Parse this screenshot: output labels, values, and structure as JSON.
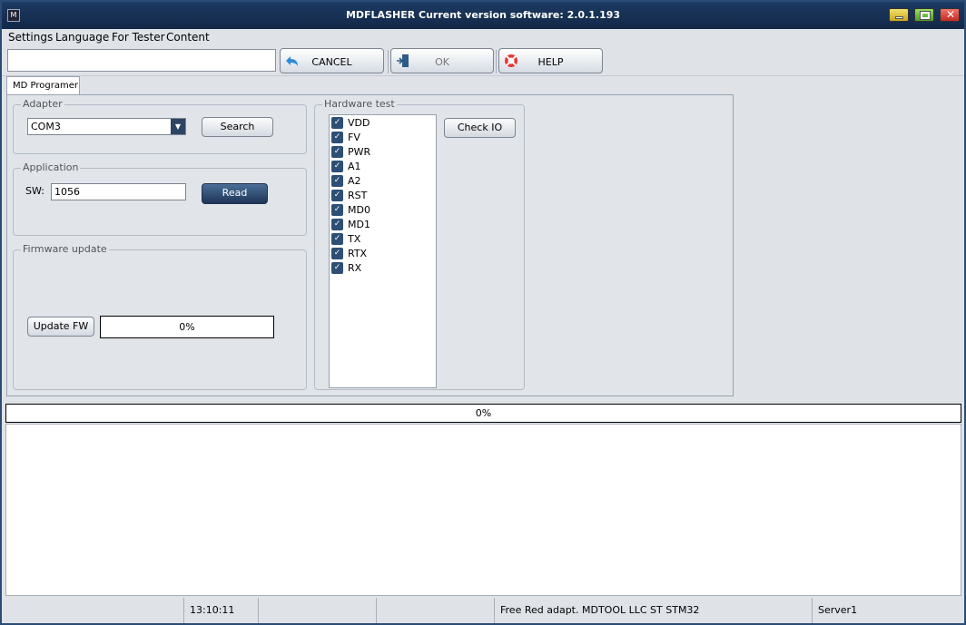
{
  "window": {
    "title": "MDFLASHER  Current version software: 2.0.1.193",
    "app_icon": "mdflasher-logo-icon"
  },
  "menu": [
    "Settings",
    "Language",
    "For Tester",
    "Content"
  ],
  "toolbar": {
    "input_value": "",
    "cancel_label": "CANCEL",
    "ok_label": "OK",
    "help_label": "HELP"
  },
  "tabs": [
    "MD Programer"
  ],
  "adapter": {
    "group_label": "Adapter",
    "selected": "COM3",
    "search_label": "Search"
  },
  "application": {
    "group_label": "Application",
    "sw_label": "SW:",
    "sw_value": "1056",
    "read_label": "Read"
  },
  "firmware": {
    "group_label": "Firmware update",
    "update_label": "Update FW",
    "progress_text": "0%"
  },
  "hardware": {
    "group_label": "Hardware test",
    "check_label": "Check IO",
    "items": [
      {
        "label": "VDD",
        "checked": true
      },
      {
        "label": "FV",
        "checked": true
      },
      {
        "label": "PWR",
        "checked": true
      },
      {
        "label": "A1",
        "checked": true
      },
      {
        "label": "A2",
        "checked": true
      },
      {
        "label": "RST",
        "checked": true
      },
      {
        "label": "MD0",
        "checked": true
      },
      {
        "label": "MD1",
        "checked": true
      },
      {
        "label": "TX",
        "checked": true
      },
      {
        "label": "RTX",
        "checked": true
      },
      {
        "label": "RX",
        "checked": true
      }
    ]
  },
  "main_progress": "0%",
  "status": {
    "time": "13:10:11",
    "info": "Free Red adapt. MDTOOL LLC ST STM32",
    "server": "Server1"
  },
  "colors": {
    "titlebar": "#122847",
    "accent": "#2e4f75",
    "close": "#c32b23"
  }
}
